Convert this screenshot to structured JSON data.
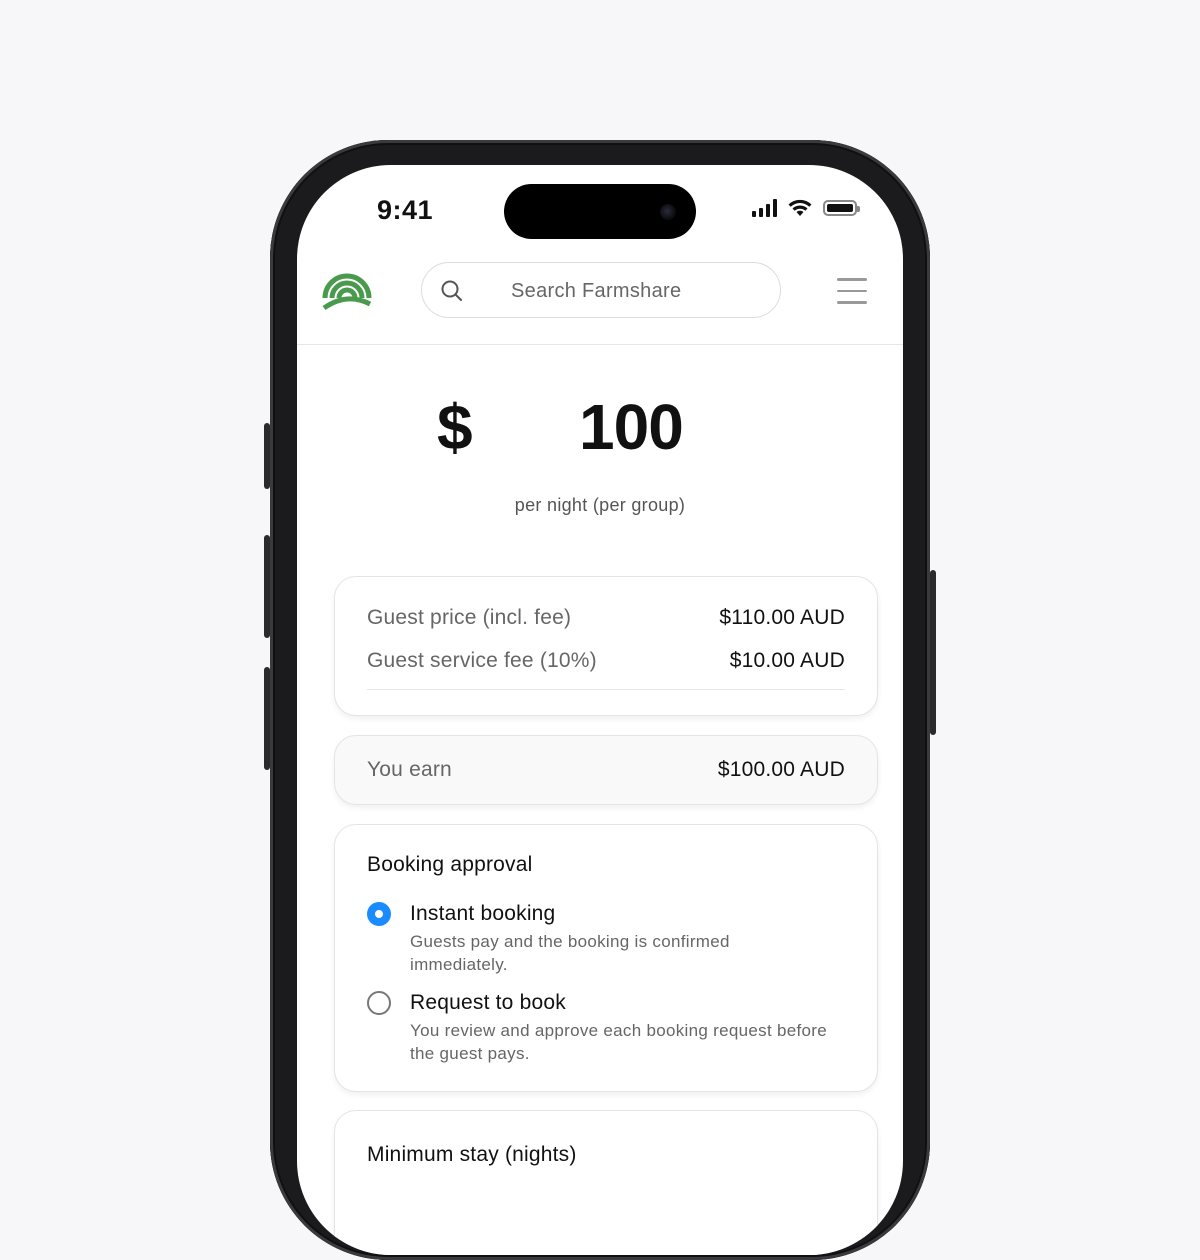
{
  "status_bar": {
    "time": "9:41"
  },
  "header": {
    "search_placeholder": "Search Farmshare"
  },
  "price": {
    "currency_symbol": "$",
    "amount": "100",
    "unit": "per night (per group)"
  },
  "breakdown": {
    "guest_price_label": "Guest price (incl. fee)",
    "guest_price_value": "$110.00 AUD",
    "service_fee_label": "Guest service fee (10%)",
    "service_fee_value": "$10.00 AUD"
  },
  "earnings": {
    "label": "You earn",
    "value": "$100.00 AUD"
  },
  "booking_approval": {
    "title": "Booking approval",
    "selected": "instant",
    "options": [
      {
        "title": "Instant booking",
        "description": "Guests pay and the booking is confirmed immediately."
      },
      {
        "title": "Request to book",
        "description": "You review and approve each booking request before the guest pays."
      }
    ]
  },
  "minimum_stay": {
    "title": "Minimum stay (nights)"
  },
  "colors": {
    "accent": "#1a8cff",
    "brand_green": "#4a9a4e"
  }
}
